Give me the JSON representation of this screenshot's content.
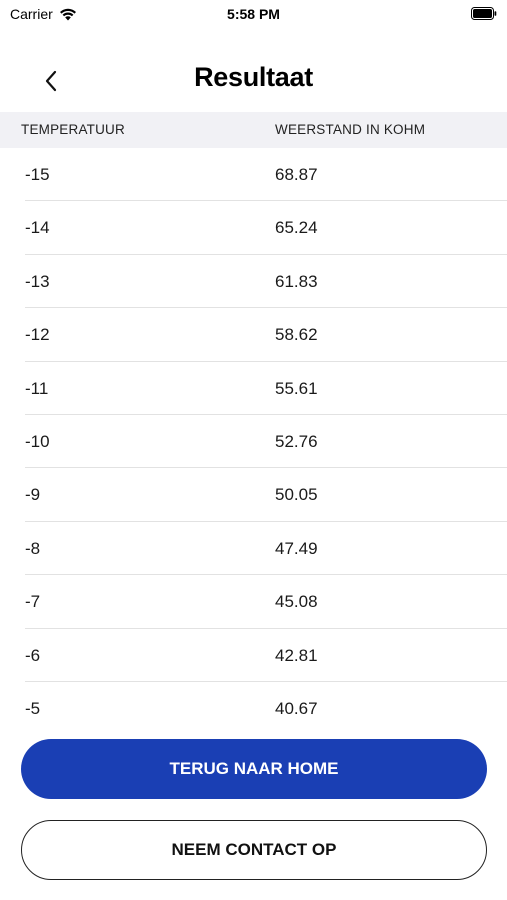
{
  "status_bar": {
    "carrier": "Carrier",
    "time": "5:58 PM"
  },
  "header": {
    "title": "Resultaat",
    "back_icon": "chevron-left-icon"
  },
  "table": {
    "columns": [
      "TEMPERATUUR",
      "WEERSTAND IN KOHM"
    ],
    "rows": [
      {
        "temp": "-15",
        "resistance": "68.87"
      },
      {
        "temp": "-14",
        "resistance": "65.24"
      },
      {
        "temp": "-13",
        "resistance": "61.83"
      },
      {
        "temp": "-12",
        "resistance": "58.62"
      },
      {
        "temp": "-11",
        "resistance": "55.61"
      },
      {
        "temp": "-10",
        "resistance": "52.76"
      },
      {
        "temp": "-9",
        "resistance": "50.05"
      },
      {
        "temp": "-8",
        "resistance": "47.49"
      },
      {
        "temp": "-7",
        "resistance": "45.08"
      },
      {
        "temp": "-6",
        "resistance": "42.81"
      },
      {
        "temp": "-5",
        "resistance": "40.67"
      }
    ]
  },
  "actions": {
    "home_label": "TERUG NAAR HOME",
    "contact_label": "NEEM CONTACT OP"
  },
  "colors": {
    "primary": "#1a3fb4",
    "header_bg": "#f1f1f5"
  }
}
